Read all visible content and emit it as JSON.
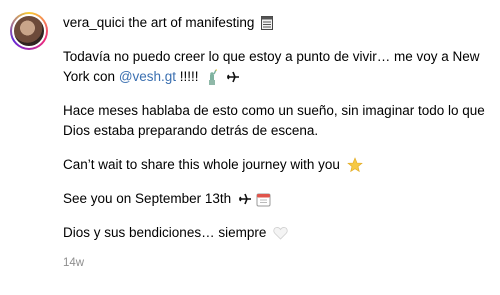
{
  "post": {
    "username": "vera_quici",
    "caption_title": "the art of manifesting",
    "title_emoji_icon": "notepad-icon",
    "paragraph_1_text": "Todavía no puedo creer lo que estoy a punto de vivir… me voy a New York con",
    "mention": "@vesh.gt",
    "paragraph_1_suffix": " !!!!!",
    "paragraph_1_icons": [
      "statue-of-liberty-icon",
      "airplane-icon"
    ],
    "paragraph_2_text": "Hace meses hablaba de esto como un sueño, sin imaginar todo lo que Dios estaba preparando detrás de escena.",
    "paragraph_3_text": "Can’t wait to share this whole journey with you",
    "paragraph_3_icon": "star-icon",
    "paragraph_4_text": "See you on September 13th",
    "paragraph_4_icons": [
      "airplane-icon",
      "calendar-icon"
    ],
    "paragraph_5_text": "Dios y sus bendiciones… siempre",
    "paragraph_5_icon": "white-heart-icon",
    "timestamp": "14w",
    "colors": {
      "mention": "#3a6fb0",
      "timestamp": "#8e8e8e",
      "text": "#000000"
    }
  }
}
